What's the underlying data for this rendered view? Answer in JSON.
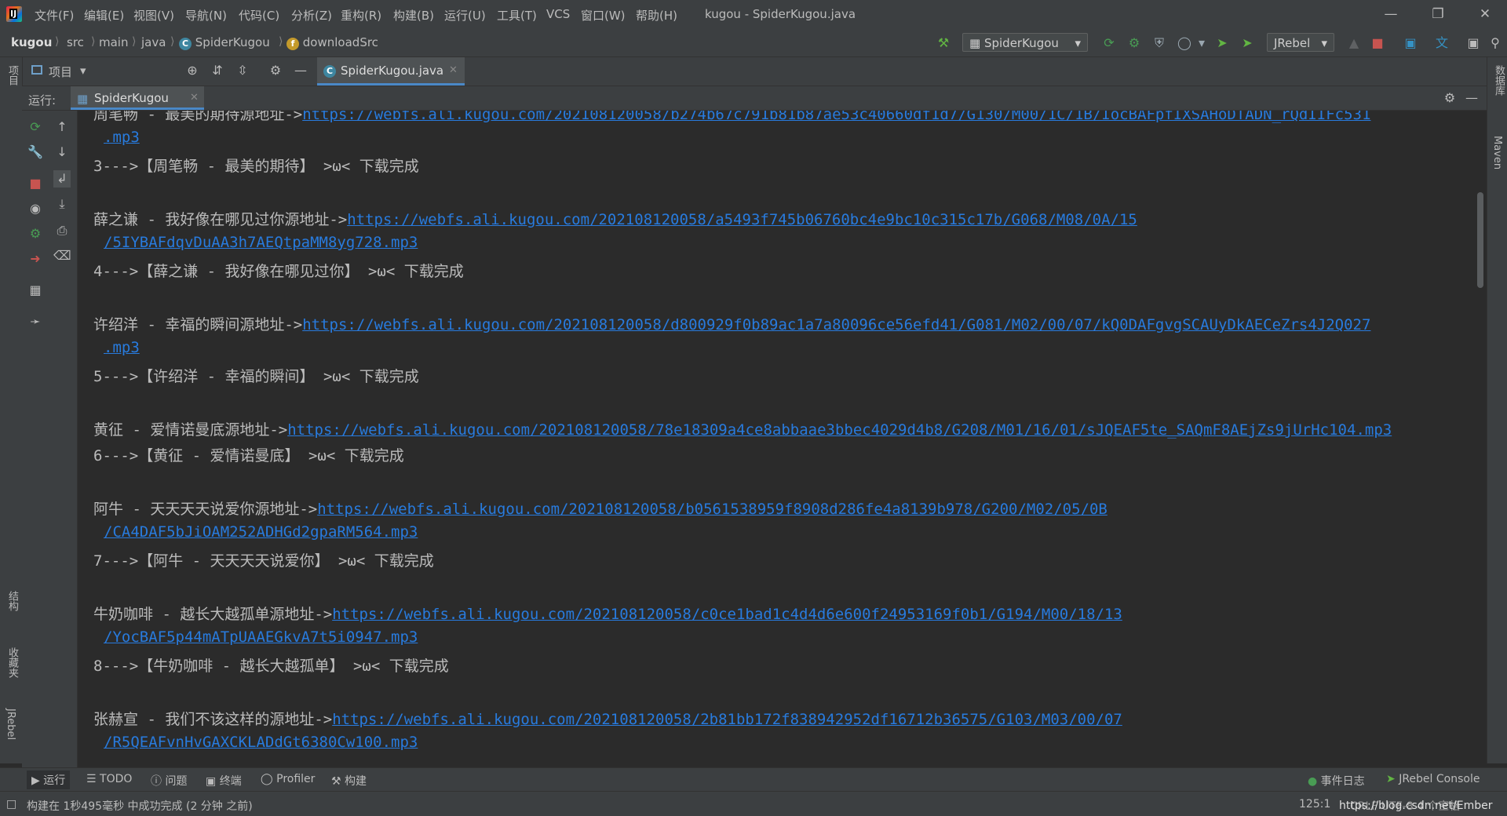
{
  "menu": {
    "items": [
      "文件(F)",
      "编辑(E)",
      "视图(V)",
      "导航(N)",
      "代码(C)",
      "分析(Z)",
      "重构(R)",
      "构建(B)",
      "运行(U)",
      "工具(T)",
      "VCS",
      "窗口(W)",
      "帮助(H)"
    ],
    "window_title": "kugou - SpiderKugou.java"
  },
  "breadcrumb": {
    "project": "kugou",
    "src": "src",
    "main": "main",
    "java": "java",
    "class": "SpiderKugou",
    "method": "downloadSrc"
  },
  "toolbar": {
    "run_config": "SpiderKugou",
    "jrebel": "JRebel"
  },
  "project_panel": {
    "label": "项目"
  },
  "editor": {
    "tab": "SpiderKugou.java"
  },
  "run_window": {
    "label": "运行:",
    "tab": "SpiderKugou"
  },
  "console": {
    "lines": [
      {
        "text": "周笔畅 - 最美的期待源地址->",
        "link": "https://webfs.ali.kugou.com/202108120058/b274b67c791b81b87ae53c40660df1d7/G130/M00/1C/1B/IocBAFpfIXSAHoDTADN_rQdIIFc531"
      },
      {
        "text": "",
        "link": ".mp3",
        "cont": true
      },
      {
        "text": "3--->【周笔畅 - 最美的期待】 >ω< 下载完成"
      },
      {
        "text": "薛之谦 - 我好像在哪见过你源地址->",
        "link": "https://webfs.ali.kugou.com/202108120058/a5493f745b06760bc4e9bc10c315c17b/G068/M08/0A/15"
      },
      {
        "text": "",
        "link": "/5IYBAFdqvDuAA3h7AEQtpaMM8yg728.mp3",
        "cont": true
      },
      {
        "text": "4--->【薛之谦 - 我好像在哪见过你】 >ω< 下载完成"
      },
      {
        "text": "许绍洋 - 幸福的瞬间源地址->",
        "link": "https://webfs.ali.kugou.com/202108120058/d800929f0b89ac1a7a80096ce56efd41/G081/M02/00/07/kQ0DAFgvgSCAUyDkAECeZrs4J2Q027"
      },
      {
        "text": "",
        "link": ".mp3",
        "cont": true
      },
      {
        "text": "5--->【许绍洋 - 幸福的瞬间】 >ω< 下载完成"
      },
      {
        "text": "黄征 - 爱情诺曼底源地址->",
        "link": "https://webfs.ali.kugou.com/202108120058/78e18309a4ce8abbaae3bbec4029d4b8/G208/M01/16/01/sJQEAF5te_SAQmF8AEjZs9jUrHc104.mp3"
      },
      {
        "text": "6--->【黄征 - 爱情诺曼底】 >ω< 下载完成"
      },
      {
        "text": "阿牛 - 天天天天说爱你源地址->",
        "link": "https://webfs.ali.kugou.com/202108120058/b0561538959f8908d286fe4a8139b978/G200/M02/05/0B"
      },
      {
        "text": "",
        "link": "/CA4DAF5bJiOAM252ADHGd2gpaRM564.mp3",
        "cont": true
      },
      {
        "text": "7--->【阿牛 - 天天天天说爱你】 >ω< 下载完成"
      },
      {
        "text": "牛奶咖啡 - 越长大越孤单源地址->",
        "link": "https://webfs.ali.kugou.com/202108120058/c0ce1bad1c4d4d6e600f24953169f0b1/G194/M00/18/13"
      },
      {
        "text": "",
        "link": "/YocBAF5p44mATpUAAEGkvA7t5i0947.mp3",
        "cont": true
      },
      {
        "text": "8--->【牛奶咖啡 - 越长大越孤单】 >ω< 下载完成"
      },
      {
        "text": "张赫宣 - 我们不该这样的源地址->",
        "link": "https://webfs.ali.kugou.com/202108120058/2b81bb172f838942952df16712b36575/G103/M03/00/07"
      },
      {
        "text": "",
        "link": "/R5QEAFvnHvGAXCKLADdGt6380Cw100.mp3",
        "cont": true
      }
    ]
  },
  "left_strip": {
    "project": "项目",
    "structure": "结构",
    "favorites": "收藏夹",
    "jrebel": "JRebel"
  },
  "right_strip": {
    "database": "数据库",
    "maven": "Maven"
  },
  "bottom_tabs": {
    "run": "运行",
    "todo": "TODO",
    "problems": "问题",
    "terminal": "终端",
    "profiler": "Profiler",
    "build": "构建",
    "event_log": "事件日志",
    "jrebel_console": "JRebel Console"
  },
  "status": {
    "message": "构建在 1秒495毫秒 中成功完成 (2 分钟 之前)",
    "position": "125:1",
    "encoding": "CRLF  UTF-8  4 个空格",
    "watermark": "https://blog.csdn.net/Ember"
  }
}
